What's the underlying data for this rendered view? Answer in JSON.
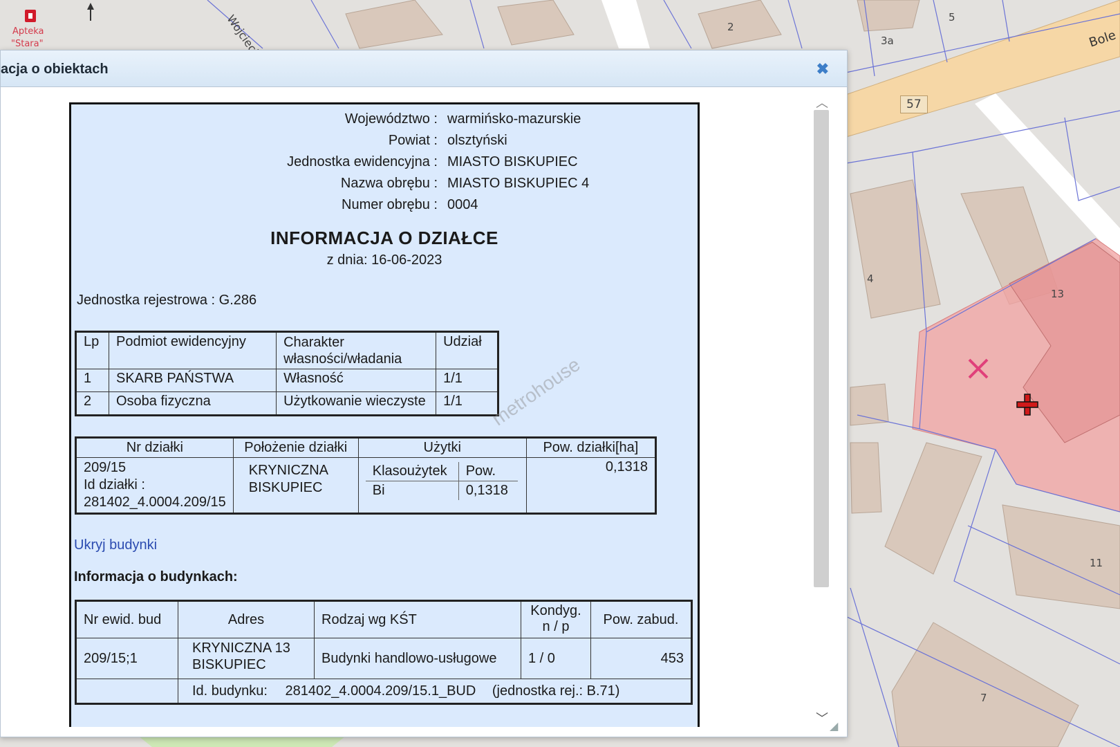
{
  "map": {
    "labels": {
      "pharmacy_name": "Apteka",
      "pharmacy_sub": "\"Stara\"",
      "street1": "Wojciecha",
      "street2": "Bole",
      "road_number": "57",
      "house_2": "2",
      "house_3a": "3a",
      "house_4": "4",
      "house_5": "5",
      "house_7": "7",
      "house_11": "11",
      "house_13": "13"
    },
    "colors": {
      "road": "#f6d7a6",
      "parcel_line": "#6b73d6",
      "building": "#d9c8bb",
      "selected_parcel": "#f2a2a2",
      "marker_x": "#e0407a",
      "marker_plus": "#d11a1a"
    },
    "icons": [
      "pharmacy-icon",
      "north-arrow-icon",
      "marker-x-icon",
      "crosshair-icon"
    ]
  },
  "dialog": {
    "title": "acja o obiektach",
    "close_icon": "close-icon"
  },
  "document": {
    "header": [
      {
        "label": "Województwo :",
        "value": "warmińsko-mazurskie"
      },
      {
        "label": "Powiat :",
        "value": "olsztyński"
      },
      {
        "label": "Jednostka ewidencyjna :",
        "value": "MIASTO BISKUPIEC"
      },
      {
        "label": "Nazwa obrębu :",
        "value": "MIASTO BISKUPIEC 4"
      },
      {
        "label": "Numer obrębu :",
        "value": "0004"
      }
    ],
    "title": "INFORMACJA O DZIAŁCE",
    "date": "z dnia: 16-06-2023",
    "jednostka_rejestrowa": "Jednostka rejestrowa : G.286",
    "owners": {
      "headers": [
        "Lp",
        "Podmiot ewidencyjny",
        "Charakter własności/władania",
        "Udział"
      ],
      "rows": [
        [
          "1",
          "SKARB PAŃSTWA",
          "Własność",
          "1/1"
        ],
        [
          "2",
          "Osoba fizyczna",
          "Użytkowanie wieczyste",
          "1/1"
        ]
      ]
    },
    "parcel": {
      "headers": [
        "Nr działki",
        "Położenie działki",
        "Użytki",
        "Pow. działki[ha]"
      ],
      "nr_line1": "209/15",
      "nr_line2": "Id działki :",
      "nr_line3": "281402_4.0004.209/15",
      "location_line1": "KRYNICZNA",
      "location_line2": "BISKUPIEC",
      "uses_headers": [
        "Klasoużytek",
        "Pow."
      ],
      "uses_row": [
        "Bi",
        "0,1318"
      ],
      "area": "0,1318"
    },
    "hide_buildings_link": "Ukryj budynki",
    "buildings_heading": "Informacja o budynkach:",
    "buildings": {
      "headers": [
        "Nr ewid. bud",
        "Adres",
        "Rodzaj wg KŚT",
        "Kondyg. n / p",
        "Pow. zabud."
      ],
      "row": {
        "nr": "209/15;1",
        "address_line1": "KRYNICZNA 13",
        "address_line2": "BISKUPIEC",
        "type": "Budynki handlowo-usługowe",
        "floors": "1 / 0",
        "area": "453"
      },
      "id_label": "Id. budynku:",
      "id_value": "281402_4.0004.209/15.1_BUD",
      "id_unit": "(jednostka rej.: B.71)"
    },
    "watermark": "metrohouse"
  }
}
